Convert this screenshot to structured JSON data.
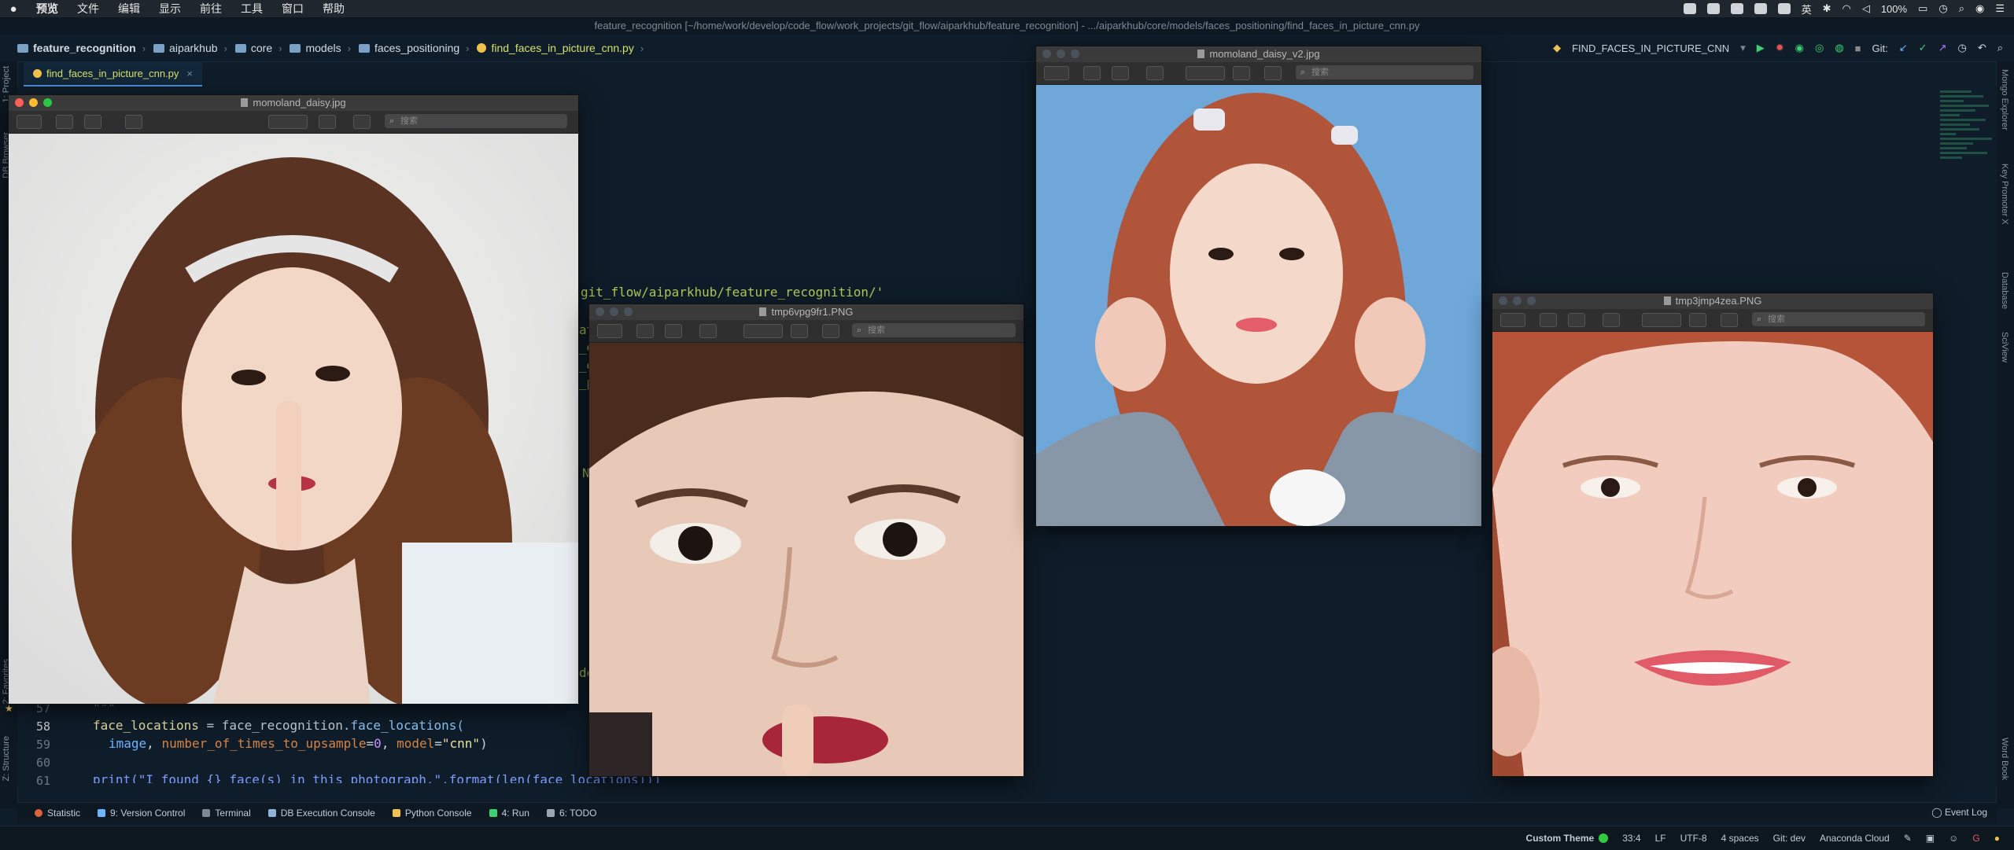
{
  "menubar": {
    "app_name": "预览",
    "items": [
      "文件",
      "编辑",
      "显示",
      "前往",
      "工具",
      "窗口",
      "帮助"
    ],
    "battery": "100%",
    "input_method": "英"
  },
  "ide": {
    "window_title": "feature_recognition [~/home/work/develop/code_flow/work_projects/git_flow/aiparkhub/feature_recognition] - .../aiparkhub/core/models/faces_positioning/find_faces_in_picture_cnn.py",
    "breadcrumbs": [
      "feature_recognition",
      "aiparkhub",
      "core",
      "models",
      "faces_positioning",
      "find_faces_in_picture_cnn.py"
    ],
    "run_config": "FIND_FACES_IN_PICTURE_CNN",
    "git_label": "Git:",
    "tab": "find_faces_in_picture_cnn.py"
  },
  "left_tools": [
    "1: Project",
    "DB Browser",
    "2: Favorites",
    "Z: Structure"
  ],
  "right_tools": [
    "Mongo Explorer",
    "Key Promoter X",
    "Database",
    "SciView",
    "Word Book"
  ],
  "editor": {
    "fragment_path": "git_flow/aiparkhub/feature_recognition/'",
    "fragment_chars": [
      "at",
      "_d",
      "_d",
      "_p",
      "N",
      "de"
    ],
    "line_numbers": [
      "57",
      "58",
      "59",
      "60",
      "61"
    ],
    "lines": {
      "l57": "\"\"\"",
      "l58_var": "face_locations",
      "l58_eq": " = ",
      "l58_mod": "face_recognition",
      "l58_fn": ".face_locations(",
      "l59_param1": "image",
      "l59_mid": ", ",
      "l59_param2": "number_of_times_to_upsample",
      "l59_eq": "=",
      "l59_num": "0",
      "l59_comma": ", ",
      "l59_param3": "model",
      "l59_eq2": "=",
      "l59_str": "\"cnn\"",
      "l59_end": ")",
      "l61": "print(\"I found {} face(s) in this photograph.\".format(len(face_locations)))"
    }
  },
  "preview_windows": [
    {
      "title": "momoland_daisy.jpg",
      "search": "搜索"
    },
    {
      "title": "tmp6vpg9fr1.PNG",
      "search": "搜索"
    },
    {
      "title": "momoland_daisy_v2.jpg",
      "search": "搜索"
    },
    {
      "title": "tmp3jmp4zea.PNG",
      "search": "搜索"
    }
  ],
  "tool_tabs": [
    "Statistic",
    "9: Version Control",
    "Terminal",
    "DB Execution Console",
    "Python Console",
    "4: Run",
    "6: TODO"
  ],
  "event_log": "Event Log",
  "statusbar": {
    "theme": "Custom Theme",
    "position": "33:4",
    "line_sep": "LF",
    "encoding": "UTF-8",
    "indent": "4 spaces",
    "git": "Git: dev",
    "cloud": "Anaconda Cloud"
  },
  "colors": {
    "bg": "#0f1d2a",
    "accent": "#4d8fd8",
    "tab_text": "#d7e06a"
  }
}
